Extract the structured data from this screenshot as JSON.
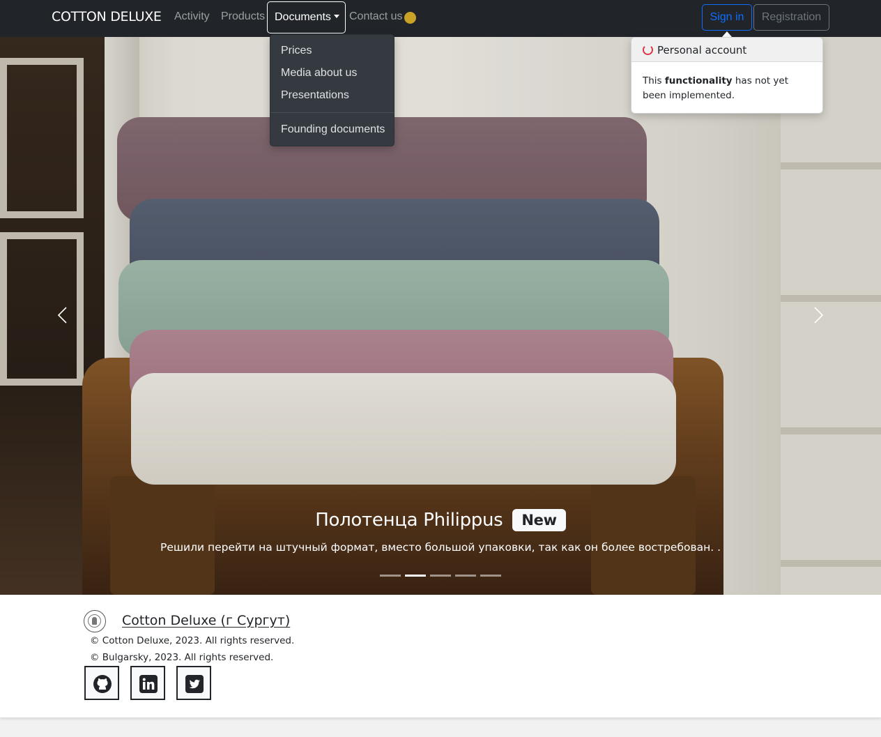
{
  "navbar": {
    "brand": "COTTON DELUXE",
    "links": {
      "activity": "Activity",
      "products": "Products",
      "documents": "Documents",
      "contact": "Contact us"
    },
    "status_dot_color": "#c9a227",
    "sign_in": "Sign in",
    "registration": "Registration"
  },
  "documents_menu": {
    "items": [
      "Prices",
      "Media about us",
      "Presentations"
    ],
    "after_divider": [
      "Founding documents"
    ]
  },
  "popover": {
    "title": "Personal account",
    "body_prefix": "This",
    "body_bold": "functionality",
    "body_suffix": "has not yet been implemented."
  },
  "carousel": {
    "caption_title": "Полотенца Philippus",
    "badge": "New",
    "caption_text": "Решили перейти на штучный формат, вместо большой упаковки, так как он более востребован. .",
    "slide_count": 5,
    "active_index": 1,
    "prev_icon": "chevron-left-icon",
    "next_icon": "chevron-right-icon"
  },
  "footer": {
    "title": "Cotton Deluxe (г Сургут)",
    "copyright_1": "© Cotton Deluxe, 2023. All rights reserved.",
    "copyright_2": "© Bulgarsky, 2023. All rights reserved.",
    "social": [
      "github-icon",
      "linkedin-icon",
      "twitter-icon"
    ]
  },
  "colors": {
    "navbar_bg": "#212529",
    "primary": "#0d6efd",
    "secondary": "#6c757d",
    "spinner": "#dc3545"
  }
}
